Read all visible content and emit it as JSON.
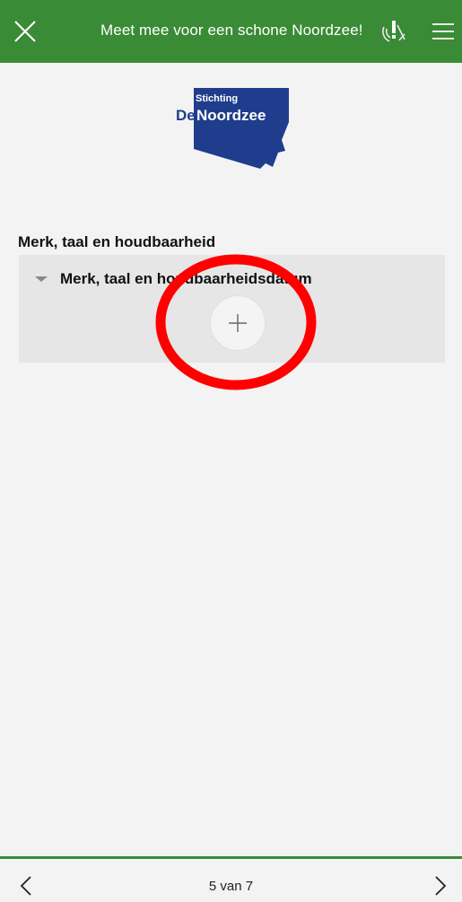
{
  "header": {
    "title": "Meet mee voor een schone Noordzee!",
    "close_icon": "close-icon",
    "status_icon": "measure-status-icon",
    "menu_icon": "hamburger-menu-icon",
    "color": "#3a8b35"
  },
  "logo": {
    "line1": "Stichting",
    "line2_prefix": "De",
    "line2_main": "Noordzee",
    "color": "#1f3d8c"
  },
  "section": {
    "title": "Merk, taal en houdbaarheid",
    "group_label": "Merk, taal en houdbaarheidsdatum",
    "add_icon": "plus-icon",
    "highlight_color": "#ff0000"
  },
  "footer": {
    "page_indicator": "5 van 7",
    "prev_icon": "chevron-left-icon",
    "next_icon": "chevron-right-icon"
  }
}
